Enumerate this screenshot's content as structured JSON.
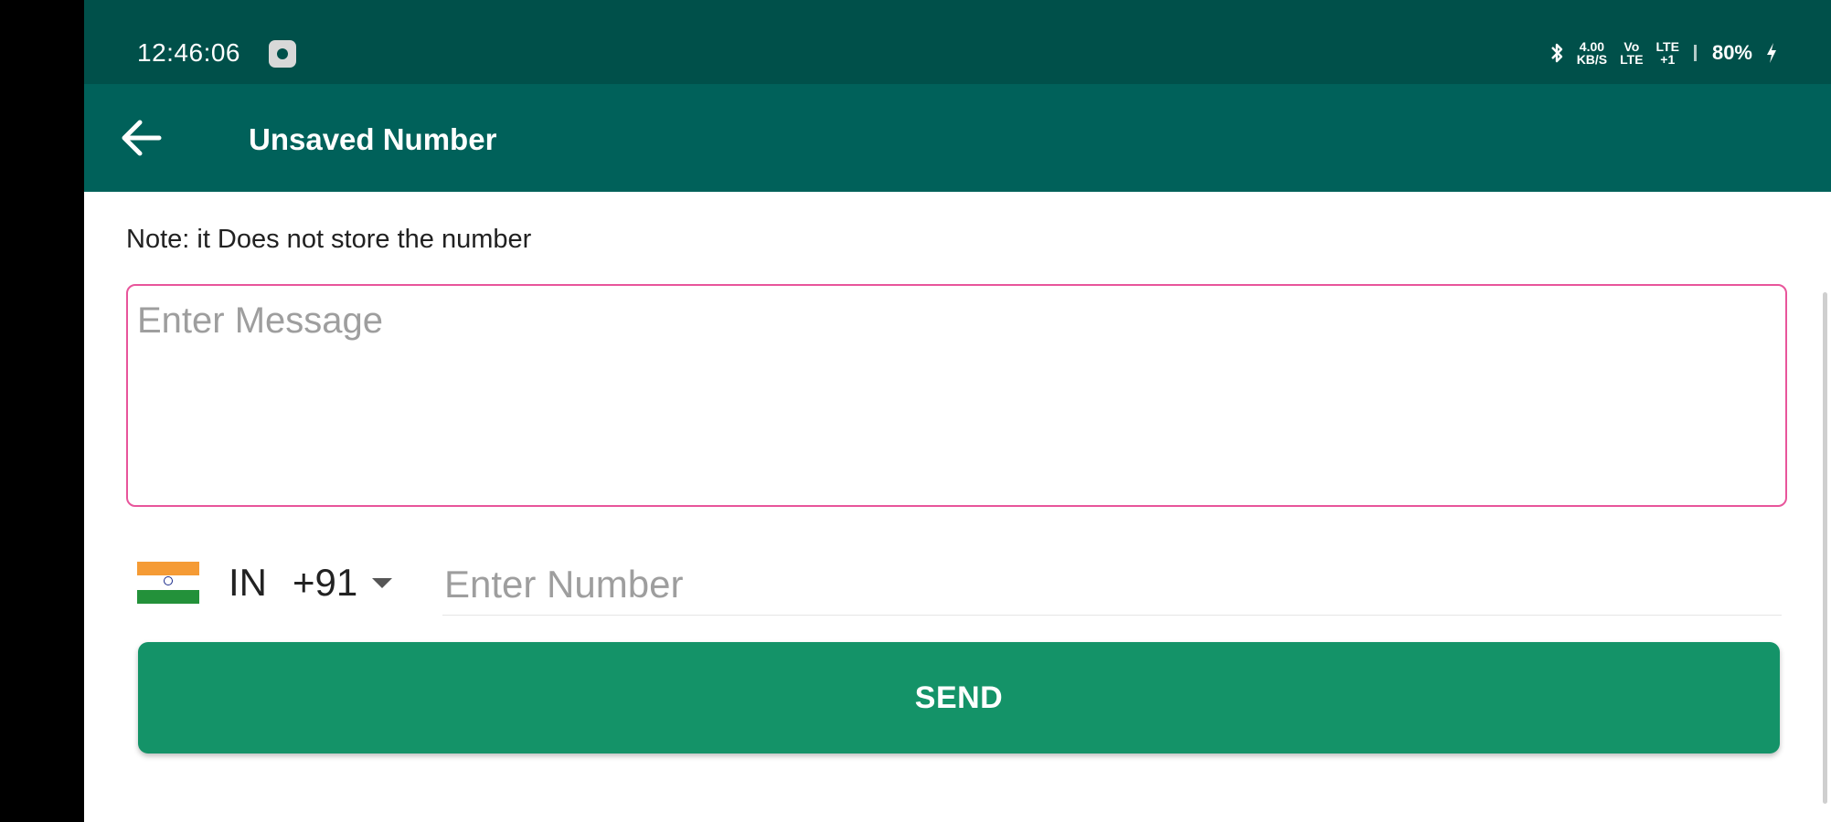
{
  "status_bar": {
    "time": "12:46:06",
    "app_icon": "settings-dot-icon",
    "bluetooth_icon": "bluetooth-icon",
    "net_speed_value": "4.00",
    "net_speed_unit": "KB/S",
    "vo_lte_top": "Vo",
    "vo_lte_bottom": "LTE",
    "signal_top": "LTE",
    "signal_bottom": "+1",
    "battery": "80%",
    "charging_icon": "lightning-icon"
  },
  "app_bar": {
    "title": "Unsaved Number",
    "back_icon": "arrow-left-icon"
  },
  "note": "Note: it Does not store the number",
  "message": {
    "placeholder": "Enter Message",
    "value": ""
  },
  "phone": {
    "country_code": "IN",
    "dial_code": "+91",
    "flag_icon": "india-flag-icon",
    "placeholder": "Enter Number",
    "value": ""
  },
  "send_button": {
    "label": "SEND"
  },
  "colors": {
    "status_bar": "#00504a",
    "app_bar": "#00615a",
    "send_button": "#149368",
    "message_border": "#e8559b"
  }
}
